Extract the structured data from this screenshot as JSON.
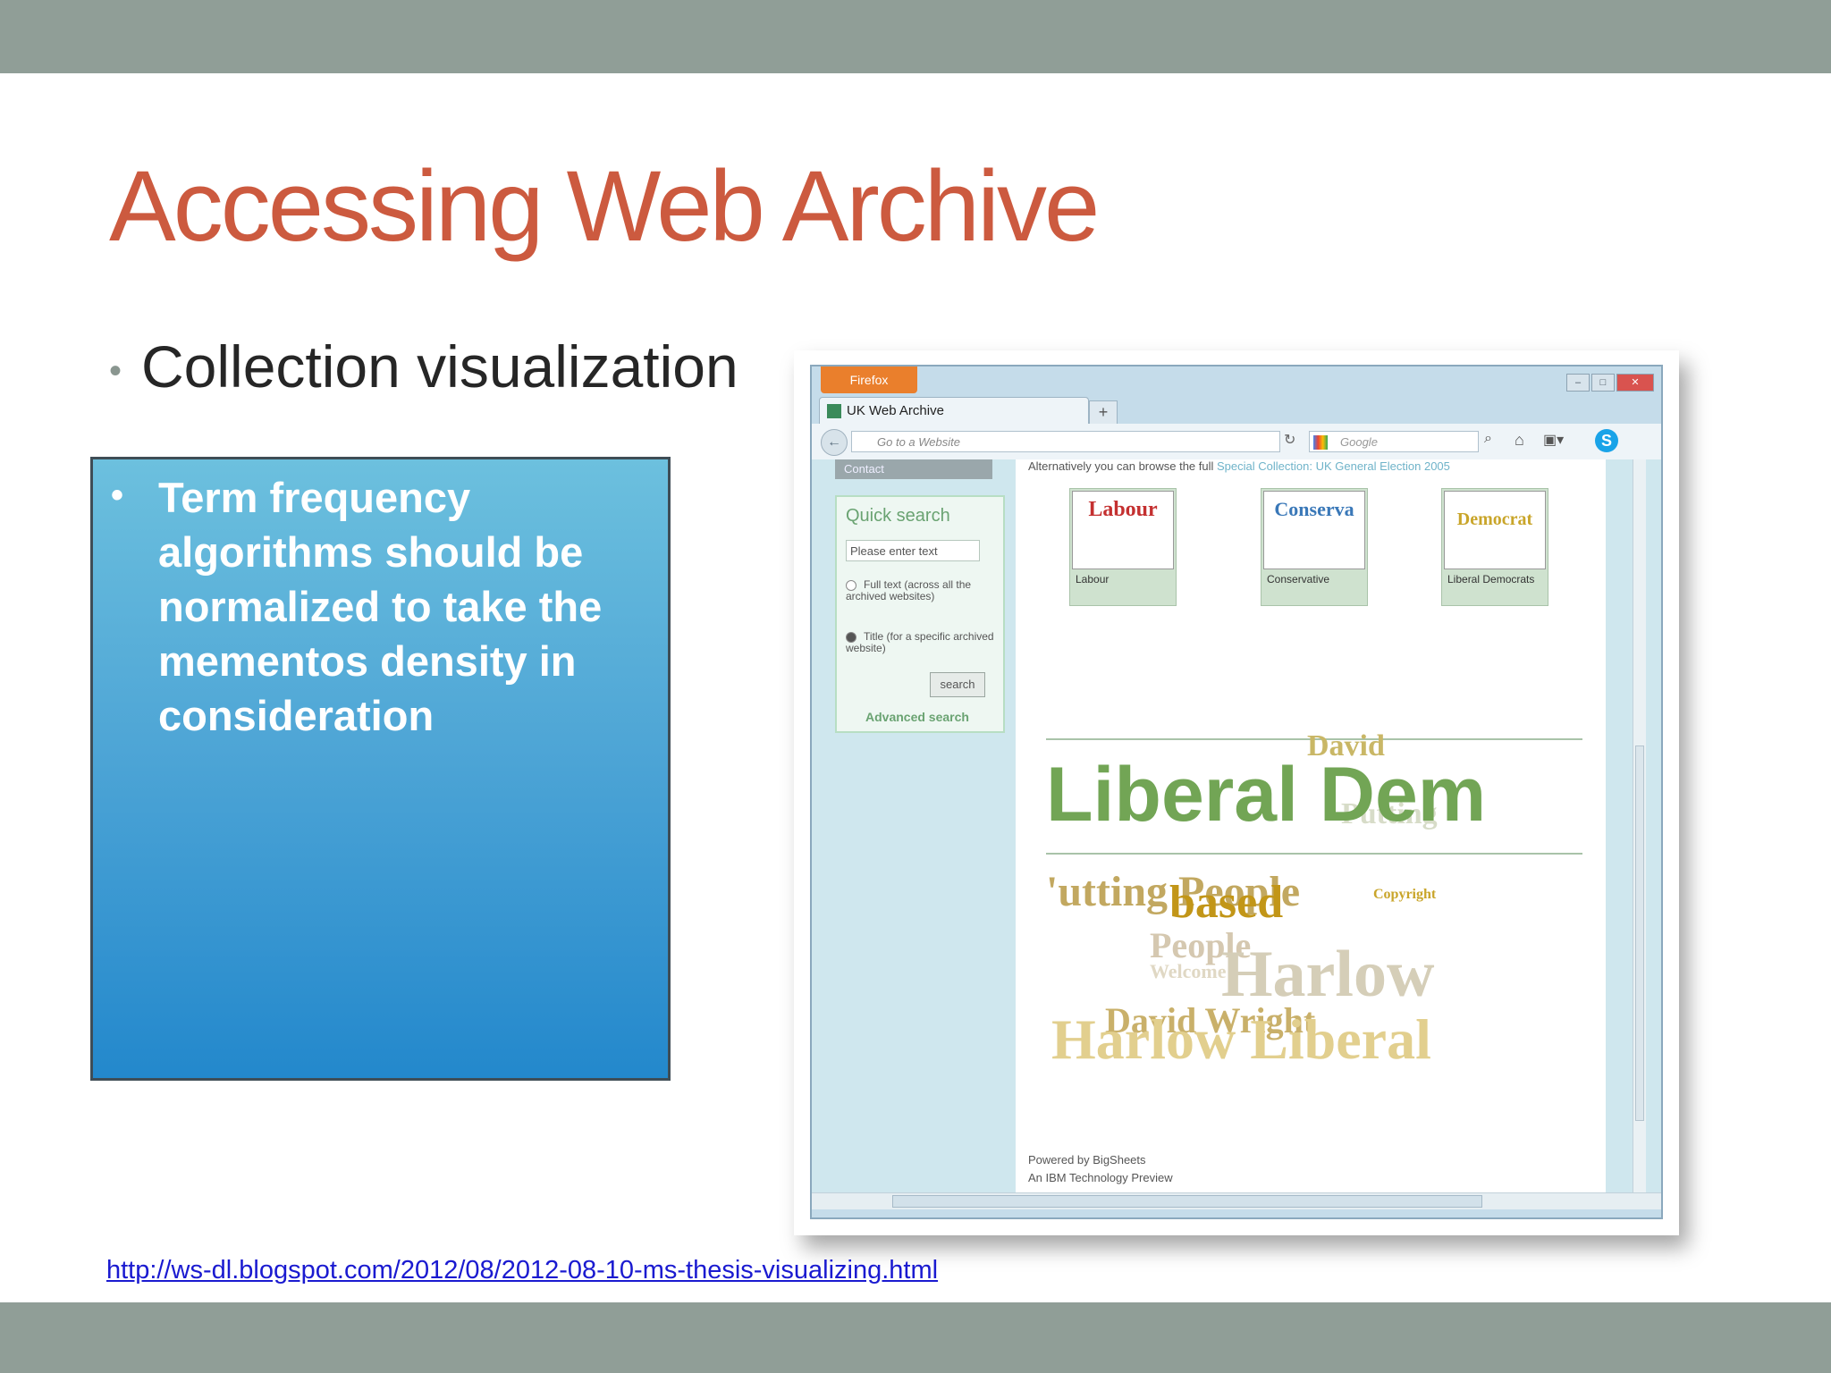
{
  "slide": {
    "title": "Accessing Web Archive",
    "bullet": "Collection visualization",
    "callout_text": "Term frequency algorithms should be normalized to take the mementos density in consideration",
    "link": "http://ws-dl.blogspot.com/2012/08/2012-08-10-ms-thesis-visualizing.html"
  },
  "colors": {
    "title": "#cc5a3f",
    "band": "#909e97",
    "callout_top": "#6cc0de",
    "callout_bottom": "#2388cc"
  },
  "browser": {
    "firefox_button": "Firefox",
    "tab_title": "UK Web Archive",
    "new_tab": "+",
    "url_placeholder": "Go to a Website",
    "search_placeholder": "Google"
  },
  "sidebar": {
    "contact": "Contact",
    "quick_search_title": "Quick search",
    "search_placeholder": "Please enter text",
    "radio_fulltext": "Full text (across all the archived websites)",
    "radio_title": "Title (for a specific archived website)",
    "search_button": "search",
    "advanced_search": "Advanced search"
  },
  "content": {
    "browse_text": "Alternatively you can browse the full",
    "browse_link": "Special Collection: UK General Election 2005",
    "parties": [
      {
        "thumb": "Labour",
        "label": "Labour"
      },
      {
        "thumb": "Conserva",
        "label": "Conservative"
      },
      {
        "thumb": "Democrat",
        "label": "Liberal Democrats"
      }
    ],
    "cloud": {
      "david": "David",
      "liberal_dem": "Liberal Dem",
      "putting": "Putting",
      "utting_people": "'utting People",
      "based": "based",
      "copyright": "Copyright",
      "people": "People",
      "welcome": "Welcome",
      "harlow": "Harlow",
      "david_wright": "David Wright",
      "harlow_liberal": "Harlow Liberal"
    },
    "footer_line1": "Powered by BigSheets",
    "footer_line2": "An IBM Technology Preview"
  }
}
